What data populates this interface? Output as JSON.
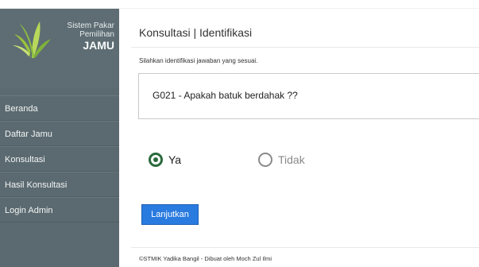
{
  "sidebar": {
    "brand": {
      "line1": "Sistem Pakar",
      "line2": "Pemilihan",
      "line3": "JAMU"
    },
    "items": [
      {
        "label": "Beranda"
      },
      {
        "label": "Daftar Jamu"
      },
      {
        "label": "Konsultasi"
      },
      {
        "label": "Hasil Konsultasi"
      },
      {
        "label": "Login Admin"
      }
    ]
  },
  "main": {
    "title": "Konsultasi | Identifikasi",
    "instruction": "Silahkan identifikasi jawaban yang sesuai.",
    "question": "G021 - Apakah batuk berdahak ??",
    "options": [
      {
        "label": "Ya",
        "selected": true
      },
      {
        "label": "Tidak",
        "selected": false
      }
    ],
    "submit_label": "Lanjutkan"
  },
  "footer": {
    "text": "©STMIK Yadika Bangil - Dibuat oleh Moch Zul Ilmi"
  },
  "colors": {
    "sidebar_bg": "#5b6a70",
    "radio_selected": "#2a6a3c",
    "button_bg": "#2a7be0"
  },
  "icons": {
    "logo": "herb-leaves-icon"
  }
}
